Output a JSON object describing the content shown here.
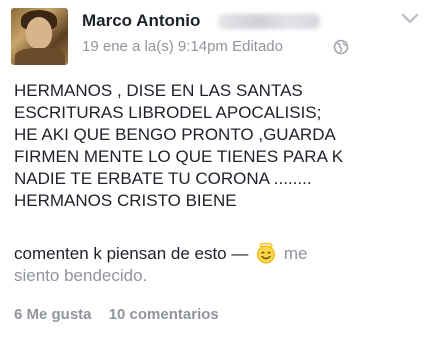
{
  "post": {
    "author": "Marco Antonio",
    "timestamp": "19 ene a la(s) 9:14pm",
    "edited_label": "Editado",
    "privacy_icon": "globe-icon",
    "menu_icon": "chevron-down-icon",
    "body_lines": [
      "HERMANOS , DISE EN LAS SANTAS",
      "ESCRITURAS LIBRODEL APOCALISIS;",
      " HE AKI  QUE BENGO PRONTO ,GUARDA",
      "FIRMEN MENTE LO QUE TIENES PARA K",
      "NADIE TE ERBATE TU CORONA ........",
      "HERMANOS CRISTO BIENE"
    ],
    "comment_text": "comenten k piensan de esto —",
    "feeling_icon": "smiley-halo-icon",
    "feeling_line1": " me",
    "feeling_line2": "siento bendecido.",
    "likes": "6 Me gusta",
    "comments": "10 comentarios"
  }
}
